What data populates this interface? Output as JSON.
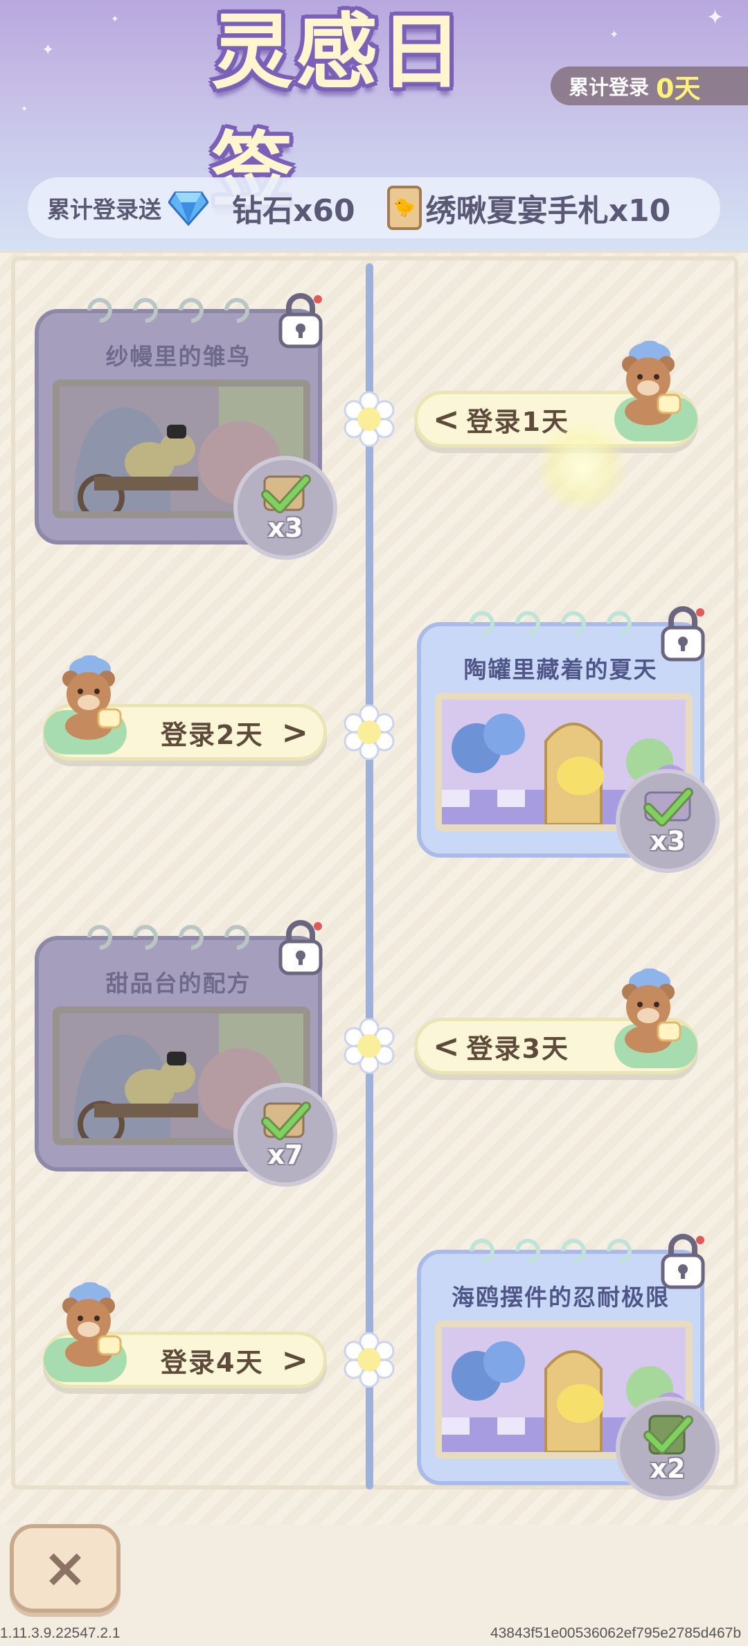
{
  "header": {
    "title": "灵感日签",
    "login_count_label": "累计登录",
    "login_count_value": "0天",
    "reward_intro": "累计登录送",
    "reward_diamond": "钻石x60",
    "reward_ticket": "绣啾夏宴手札x10"
  },
  "cards": [
    {
      "title": "纱幔里的雏鸟",
      "qty": "x3",
      "state": "locked"
    },
    {
      "title": "陶罐里藏着的夏天",
      "qty": "x3",
      "state": "unlocked"
    },
    {
      "title": "甜品台的配方",
      "qty": "x7",
      "state": "locked"
    },
    {
      "title": "海鸥摆件的忍耐极限",
      "qty": "x2",
      "state": "unlocked"
    }
  ],
  "days": [
    {
      "label": "登录1天",
      "arrow": "<"
    },
    {
      "label": "登录2天",
      "arrow": ">"
    },
    {
      "label": "登录3天",
      "arrow": "<"
    },
    {
      "label": "登录4天",
      "arrow": ">"
    }
  ],
  "close_label": "×",
  "footer": {
    "version": "1.11.3.9.22547.2.1",
    "hash": "43843f51e00536062ef795e2785d467b"
  },
  "icons": {
    "diamond": "diamond-icon",
    "ticket": "ticket-icon",
    "lock": "lock-icon",
    "check": "check-icon",
    "flower": "flower-icon",
    "bear": "bear-icon",
    "close": "close-icon"
  },
  "colors": {
    "accent_purple": "#7a61b7",
    "timeline": "#9fb1db",
    "pill": "#fbf6d7",
    "count_value": "#fff27a"
  }
}
